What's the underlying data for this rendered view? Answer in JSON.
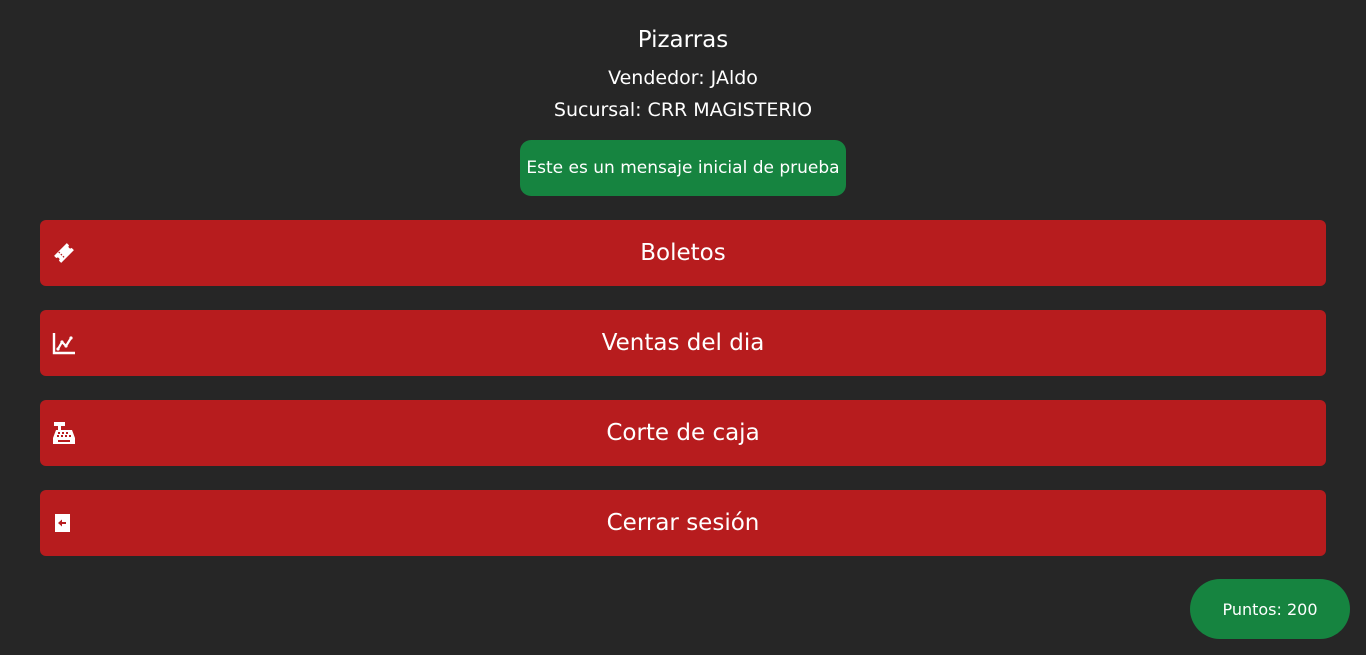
{
  "header": {
    "title": "Pizarras",
    "vendor": "Vendedor: JAldo",
    "branch": "Sucursal: CRR MAGISTERIO",
    "message": "Este es un mensaje inicial de prueba"
  },
  "menu": [
    {
      "label": "Boletos",
      "icon": "ticket-icon"
    },
    {
      "label": "Ventas del dia",
      "icon": "chart-line-icon"
    },
    {
      "label": "Corte de caja",
      "icon": "cash-register-icon"
    },
    {
      "label": "Cerrar sesión",
      "icon": "logout-icon"
    }
  ],
  "points": {
    "label": "Puntos: 200"
  },
  "colors": {
    "background": "#262626",
    "button_red": "#b71c1e",
    "accent_green": "#168440",
    "text": "#ffffff"
  }
}
